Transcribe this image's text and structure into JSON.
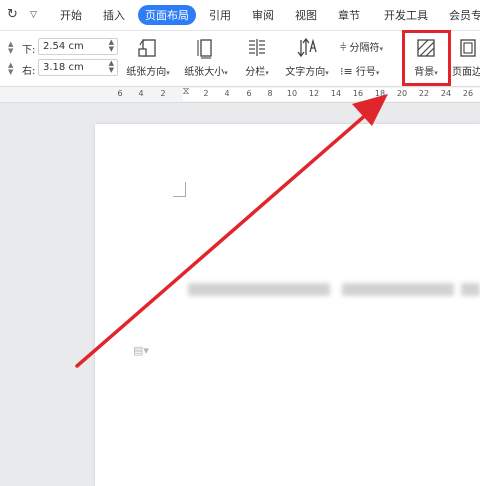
{
  "menubar": {
    "redo_icon": "redo-icon",
    "dropdown_icon": "chevron-down-icon",
    "tabs": [
      {
        "label": "开始"
      },
      {
        "label": "插入"
      },
      {
        "label": "页面布局",
        "active": true
      },
      {
        "label": "引用"
      },
      {
        "label": "审阅"
      },
      {
        "label": "视图"
      },
      {
        "label": "章节"
      },
      {
        "label": "开发工具"
      },
      {
        "label": "会员专"
      }
    ],
    "active_color": "#2e7cf6"
  },
  "ribbon": {
    "margins": {
      "bottom_label": "下:",
      "bottom_value": "2.54 cm",
      "right_label": "右:",
      "right_value": "3.18 cm"
    },
    "buttons": {
      "orientation": "纸张方向",
      "size": "纸张大小",
      "columns": "分栏",
      "text_direction": "文字方向",
      "separator": "分隔符",
      "line_number": "行号",
      "background": "背景",
      "page_border": "页面边"
    },
    "highlight_color": "#e0262c"
  },
  "ruler": {
    "ticks": [
      "6",
      "4",
      "2",
      "2",
      "4",
      "6",
      "8",
      "10",
      "12",
      "14",
      "16",
      "18",
      "20",
      "22",
      "24",
      "26"
    ]
  },
  "annotation": {
    "arrow_color": "#e0262c"
  }
}
